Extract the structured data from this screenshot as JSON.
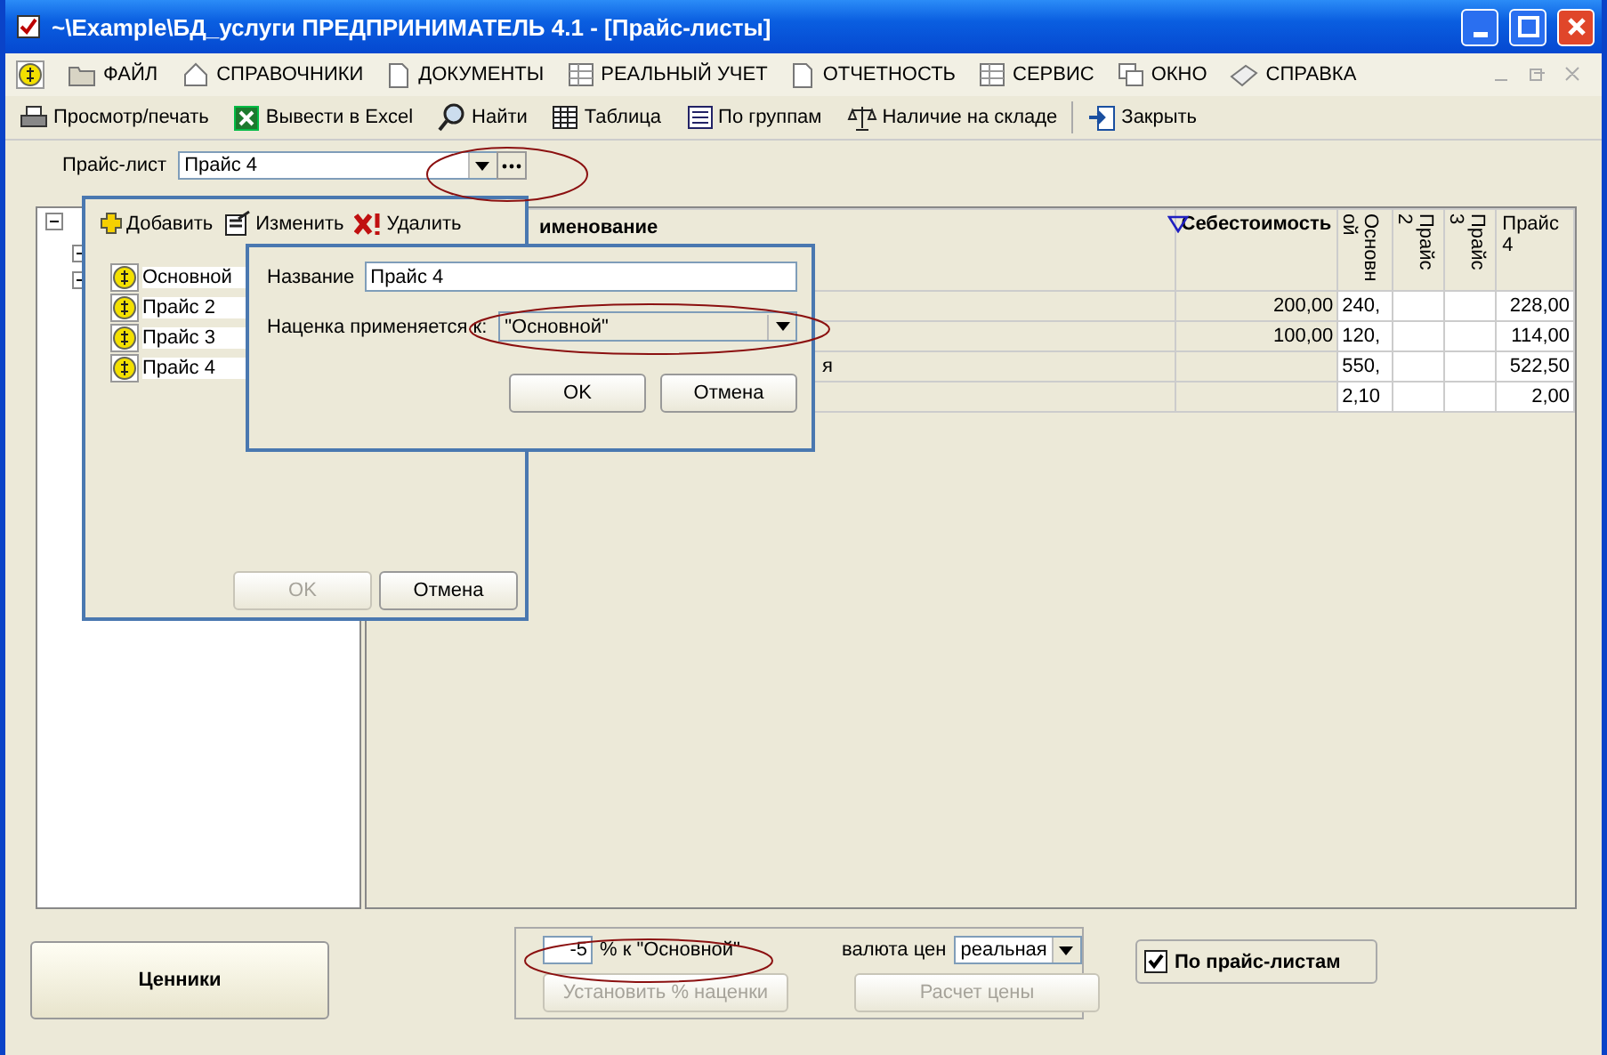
{
  "window": {
    "title": "~\\Example\\БД_услуги  ПРЕДПРИНИМАТЕЛЬ 4.1 - [Прайс-листы]"
  },
  "menu": [
    {
      "label": "ФАЙЛ"
    },
    {
      "label": "СПРАВОЧНИКИ"
    },
    {
      "label": "ДОКУМЕНТЫ"
    },
    {
      "label": "РЕАЛЬНЫЙ УЧЕТ"
    },
    {
      "label": "ОТЧЕТНОСТЬ"
    },
    {
      "label": "СЕРВИС"
    },
    {
      "label": "ОКНО"
    },
    {
      "label": "СПРАВКА"
    }
  ],
  "toolbar": [
    {
      "label": "Просмотр/печать"
    },
    {
      "label": "Вывести в Excel"
    },
    {
      "label": "Найти"
    },
    {
      "label": "Таблица"
    },
    {
      "label": "По группам"
    },
    {
      "label": "Наличие на складе"
    },
    {
      "label": "Закрыть"
    }
  ],
  "price_list_selector": {
    "label": "Прайс-лист",
    "value": "Прайс 4"
  },
  "table": {
    "columns": [
      {
        "label": "именование",
        "kind": "plain"
      },
      {
        "label": "Себестоимость",
        "kind": "plain"
      },
      {
        "label": "Основной",
        "kind": "vertical"
      },
      {
        "label": "Прайс 2",
        "kind": "vertical"
      },
      {
        "label": "Прайс 3",
        "kind": "vertical"
      },
      {
        "label": "Прайс 4",
        "kind": "plain"
      }
    ],
    "rows": [
      [
        "",
        "200,00",
        "240,",
        "",
        "",
        "228,00"
      ],
      [
        "",
        "100,00",
        "120,",
        "",
        "",
        "114,00"
      ],
      [
        "я",
        "",
        "550,",
        "",
        "",
        "522,50"
      ],
      [
        "",
        "",
        "2,10",
        "",
        "",
        "2,00"
      ]
    ]
  },
  "price_lists_dialog": {
    "actions": [
      {
        "label": "Добавить"
      },
      {
        "label": "Изменить"
      },
      {
        "label": "Удалить"
      }
    ],
    "items": [
      {
        "label": "Основной"
      },
      {
        "label": "Прайс 2"
      },
      {
        "label": "Прайс 3"
      },
      {
        "label": "Прайс 4"
      }
    ],
    "buttons": [
      {
        "label": "OK",
        "disabled": true
      },
      {
        "label": "Отмена",
        "disabled": false
      }
    ]
  },
  "edit_dialog": {
    "name_label": "Название",
    "name_value": "Прайс 4",
    "markup_label": "Наценка применяется к:",
    "markup_value": "\"Основной\"",
    "buttons": [
      {
        "label": "OK",
        "disabled": false
      },
      {
        "label": "Отмена",
        "disabled": false
      }
    ]
  },
  "bottom": {
    "price_tags_button": "Ценники",
    "markup_value": "-5",
    "markup_label": "% к \"Основной\"",
    "set_markup_button": {
      "label": "Установить % наценки",
      "disabled": true
    },
    "currency_label": "валюта цен",
    "currency_value": "реальная",
    "calc_button": {
      "label": "Расчет цены",
      "disabled": true
    },
    "by_price_lists": {
      "label": "По прайс-листам",
      "checked": true
    }
  }
}
